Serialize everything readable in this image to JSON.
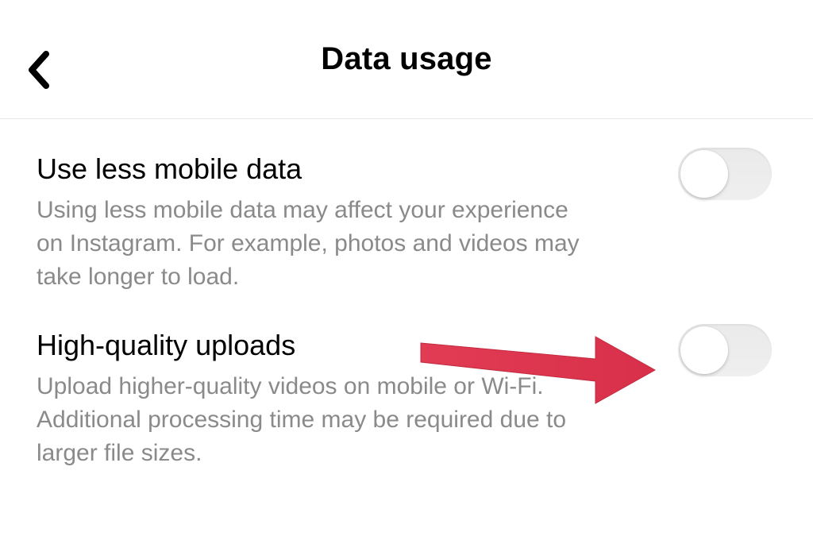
{
  "header": {
    "title": "Data usage"
  },
  "settings": [
    {
      "title": "Use less mobile data",
      "description": "Using less mobile data may affect your experience on Instagram. For example, photos and videos may take longer to load."
    },
    {
      "title": "High-quality uploads",
      "description": "Upload higher-quality videos on mobile or Wi-Fi. Additional processing time may be required due to larger file sizes."
    }
  ],
  "annotation": {
    "arrow_color": "#dc3545"
  }
}
